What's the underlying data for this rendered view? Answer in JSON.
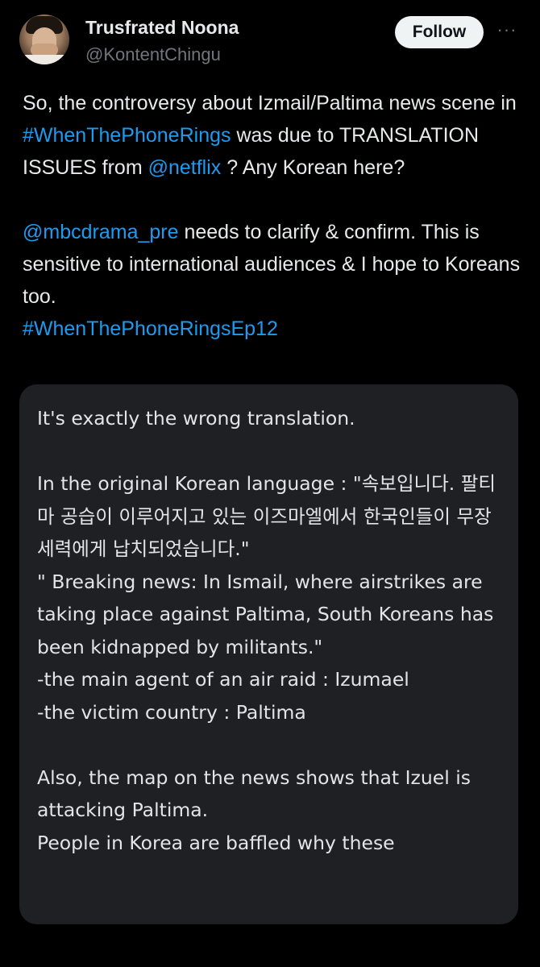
{
  "user": {
    "name": "Trusfrated Noona",
    "handle": "@KontentChingu",
    "follow_label": "Follow",
    "more_label": "···"
  },
  "tweet": {
    "p1": {
      "s1": "So, the controversy about Izmail/Paltima news scene in ",
      "hashtag1": "#WhenThePhoneRings",
      "s2": " was due to TRANSLATION ISSUES from ",
      "mention1": "@netflix",
      "s3": " ? Any Korean here?"
    },
    "p2": {
      "mention2": "@mbcdrama_pre",
      "s4": " needs to clarify & confirm. This is sensitive to international audiences & I hope to Koreans too.",
      "hashtag2": "#WhenThePhoneRingsEp12"
    }
  },
  "screenshot": {
    "line1": "It's exactly the wrong translation.",
    "line2": "In the original Korean language : \"속보입니다. 팔티마 공습이 이루어지고 있는 이즈마엘에서 한국인들이 무장 세력에게 납치되었습니다.\"",
    "line3": "\" Breaking news: In Ismail, where airstrikes are taking place against Paltima, South Koreans has been kidnapped by militants.\"",
    "line4": "-the main agent of an air raid : Izumael",
    "line5": "-the victim country : Paltima",
    "line6": "Also, the map on the news shows that Izuel is attacking Paltima.",
    "line7": "People in Korea are baffled why these"
  },
  "colors": {
    "background": "#000000",
    "text": "#e7e9ea",
    "secondary": "#71767b",
    "link": "#1d9bf0",
    "media_bg": "#1f2024"
  }
}
